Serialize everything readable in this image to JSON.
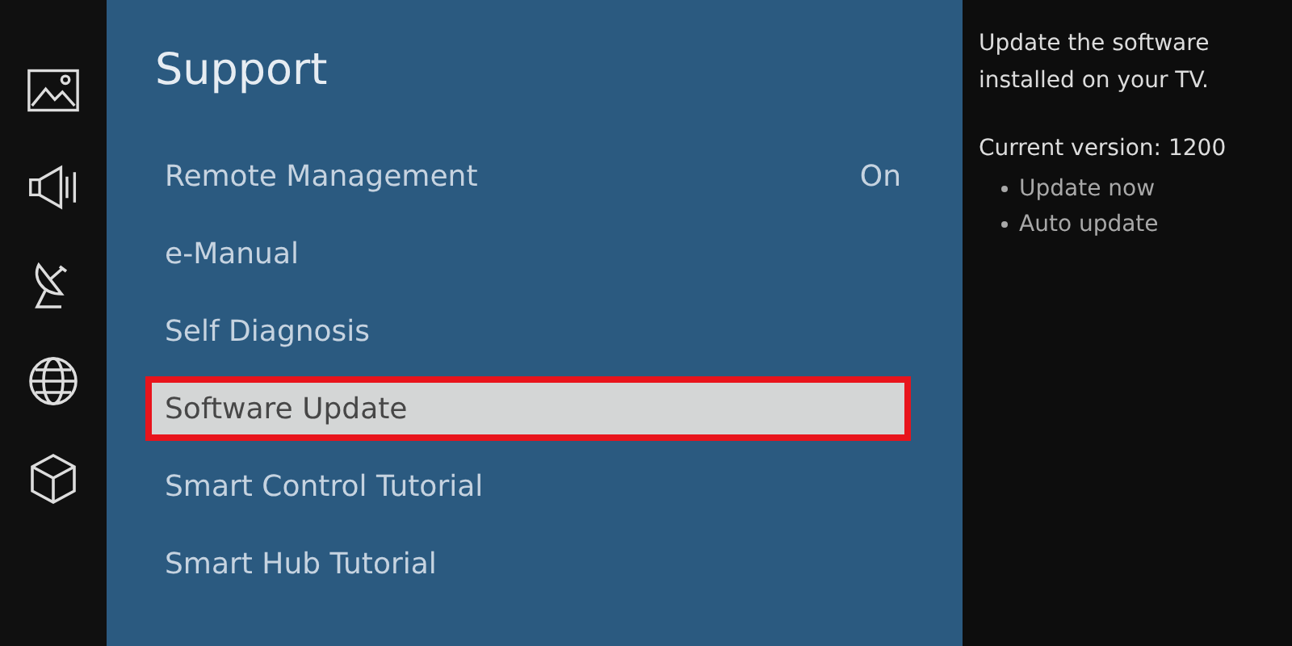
{
  "menu": {
    "title": "Support",
    "items": [
      {
        "label": "Remote Management",
        "value": "On",
        "selected": false
      },
      {
        "label": "e-Manual",
        "selected": false
      },
      {
        "label": "Self Diagnosis",
        "selected": false
      },
      {
        "label": "Software Update",
        "selected": true
      },
      {
        "label": "Smart Control Tutorial",
        "selected": false
      },
      {
        "label": "Smart Hub Tutorial",
        "selected": false
      }
    ]
  },
  "info": {
    "description": "Update the software installed on your TV.",
    "version": "Current version: 1200",
    "options": [
      "Update now",
      "Auto update"
    ]
  }
}
